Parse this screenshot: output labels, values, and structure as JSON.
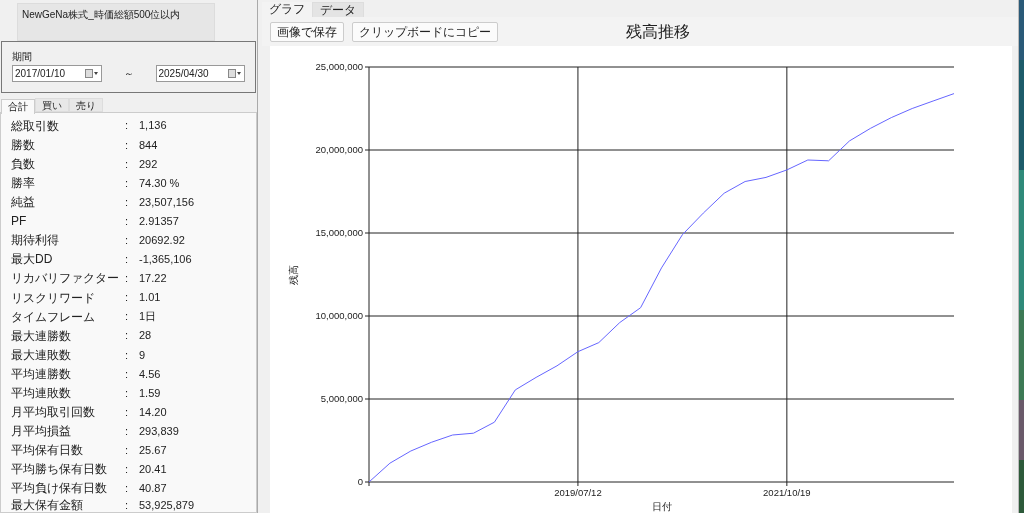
{
  "strategy_label": "NewGeNa株式_時価総額500位以内",
  "period": {
    "label": "期間",
    "from": "2017/01/10",
    "separator": "～",
    "to": "2025/04/30"
  },
  "stat_tabs": [
    {
      "label": "合計",
      "selected": true
    },
    {
      "label": "買い",
      "selected": false
    },
    {
      "label": "売り",
      "selected": false
    }
  ],
  "stat_separator": ":",
  "stats": [
    {
      "label": "総取引数",
      "value": "1,136"
    },
    {
      "label": "勝数",
      "value": "844"
    },
    {
      "label": "負数",
      "value": "292"
    },
    {
      "label": "勝率",
      "value": "74.30 %"
    },
    {
      "label": "純益",
      "value": "23,507,156"
    },
    {
      "label": "PF",
      "value": "2.91357"
    },
    {
      "label": "期待利得",
      "value": "20692.92"
    },
    {
      "label": "最大DD",
      "value": "-1,365,106"
    },
    {
      "label": "リカバリファクター",
      "value": "17.22"
    },
    {
      "label": "リスクリワード",
      "value": "1.01"
    },
    {
      "label": "タイムフレーム",
      "value": "1日"
    },
    {
      "label": "最大連勝数",
      "value": "28"
    },
    {
      "label": "最大連敗数",
      "value": "9"
    },
    {
      "label": "平均連勝数",
      "value": "4.56"
    },
    {
      "label": "平均連敗数",
      "value": "1.59"
    },
    {
      "label": "月平均取引回数",
      "value": "14.20"
    },
    {
      "label": "月平均損益",
      "value": "293,839"
    },
    {
      "label": "平均保有日数",
      "value": "25.67"
    },
    {
      "label": "平均勝ち保有日数",
      "value": "20.41"
    },
    {
      "label": "平均負け保有日数",
      "value": "40.87"
    },
    {
      "label": "最大保有金額",
      "value": "53,925,879"
    }
  ],
  "view_tabs": [
    {
      "label": "グラフ",
      "selected": true
    },
    {
      "label": "データ",
      "selected": false
    }
  ],
  "buttons": [
    "画像で保存",
    "クリップボードにコピー"
  ],
  "chart_title": "残高推移",
  "chart_data": {
    "type": "line",
    "grid": true,
    "xlabel": "日付",
    "ylabel": "残高",
    "categories": [
      null,
      null,
      null,
      null,
      null,
      null,
      null,
      null,
      null,
      null,
      "2019/07/12",
      null,
      null,
      null,
      null,
      null,
      null,
      null,
      null,
      null,
      "2021/10/19",
      null,
      null,
      null,
      null,
      null,
      null,
      null,
      null
    ],
    "series": [
      {
        "color": "#6666ff",
        "values": [
          0,
          1130000,
          1870000,
          2400000,
          2830000,
          2940000,
          3600000,
          5550000,
          6300000,
          7000000,
          7850000,
          8400000,
          9600000,
          10500000,
          12900000,
          14900000,
          16200000,
          17400000,
          18100000,
          18350000,
          18800000,
          19400000,
          19350000,
          20550000,
          21300000,
          21950000,
          22500000,
          22950000,
          23400000
        ]
      }
    ],
    "ylim": [
      0,
      25000000
    ],
    "yticks": [
      {
        "value": 0,
        "label": "0"
      },
      {
        "value": 5000000,
        "label": "5,000,000"
      },
      {
        "value": 10000000,
        "label": "10,000,000"
      },
      {
        "value": 15000000,
        "label": "15,000,000"
      },
      {
        "value": 20000000,
        "label": "20,000,000"
      },
      {
        "value": 25000000,
        "label": "25,000,000"
      }
    ]
  },
  "desktop": {
    "kind": "picture"
  }
}
